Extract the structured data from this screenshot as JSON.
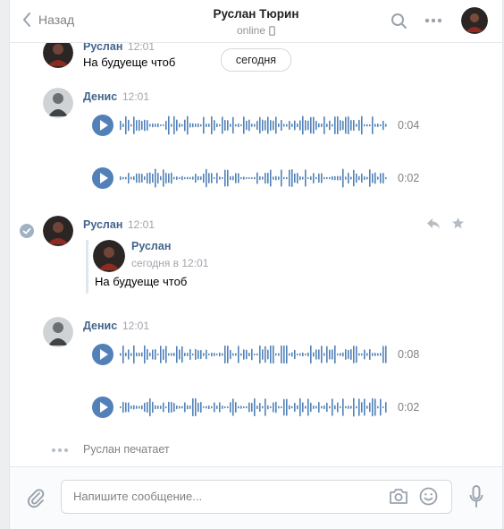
{
  "header": {
    "back_label": "Назад",
    "title": "Руслан Тюрин",
    "status": "online"
  },
  "date_divider": "сегодня",
  "messages": [
    {
      "author": "Руслан",
      "time": "12:01",
      "text": "На будуеще чтоб"
    },
    {
      "author": "Денис",
      "time": "12:01",
      "audio": [
        {
          "duration": "0:04"
        },
        {
          "duration": "0:02"
        }
      ]
    },
    {
      "author": "Руслан",
      "time": "12:01",
      "forwarded": {
        "author": "Руслан",
        "time": "сегодня в 12:01",
        "text": "На будуеще чтоб"
      }
    },
    {
      "author": "Денис",
      "time": "12:01",
      "audio": [
        {
          "duration": "0:08"
        },
        {
          "duration": "0:02"
        }
      ]
    }
  ],
  "typing": "Руслан печатает",
  "composer": {
    "placeholder": "Напишите сообщение..."
  },
  "colors": {
    "accent": "#5181b8",
    "name": "#42648b",
    "muted": "#828282"
  }
}
